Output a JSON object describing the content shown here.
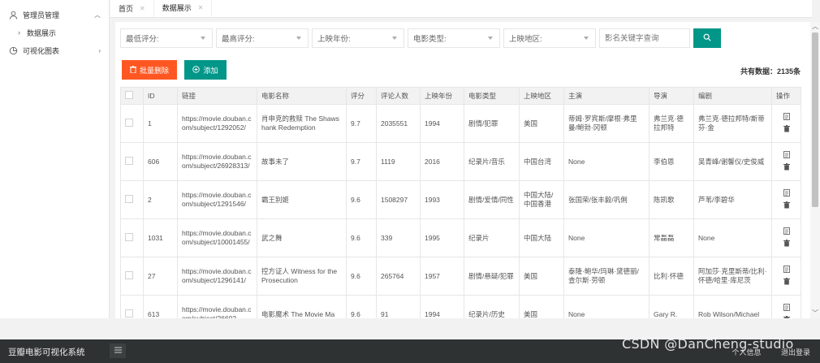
{
  "sidebar": {
    "items": [
      {
        "label": "管理员管理",
        "icon": "user-icon"
      },
      {
        "label": "数据展示"
      },
      {
        "label": "可视化图表",
        "icon": "chart-icon"
      }
    ]
  },
  "tabs": [
    {
      "label": "首页"
    },
    {
      "label": "数据展示"
    }
  ],
  "filters": {
    "min_rating": "最低评分:",
    "max_rating": "最高评分:",
    "year": "上映年份:",
    "type": "电影类型:",
    "region": "上映地区:",
    "search_placeholder": "影名关键字查询"
  },
  "toolbar": {
    "delete_label": "批量删除",
    "add_label": "添加",
    "total_text": "共有数据：2135条"
  },
  "table": {
    "headers": [
      "ID",
      "链接",
      "电影名称",
      "评分",
      "评论人数",
      "上映年份",
      "电影类型",
      "上映地区",
      "主演",
      "导演",
      "编剧",
      "操作"
    ],
    "rows": [
      {
        "id": "1",
        "link": "https://movie.douban.com/subject/1292052/",
        "name": "肖申克的救赎 The Shawshank Redemption",
        "rating": "9.7",
        "reviews": "2035551",
        "year": "1994",
        "type": "剧情/犯罪",
        "region": "美国",
        "actors": "蒂姆·罗宾斯/摩根·弗里曼/鲍勃·冈顿",
        "director": "弗兰克·德拉邦特",
        "writer": "弗兰克·德拉邦特/斯蒂芬·金"
      },
      {
        "id": "606",
        "link": "https://movie.douban.com/subject/26928313/",
        "name": "故事未了",
        "rating": "9.7",
        "reviews": "1119",
        "year": "2016",
        "type": "纪录片/音乐",
        "region": "中国台湾",
        "actors": "None",
        "director": "李伯恩",
        "writer": "吴青峰/谢馨仪/史俊威"
      },
      {
        "id": "2",
        "link": "https://movie.douban.com/subject/1291546/",
        "name": "霸王别姬",
        "rating": "9.6",
        "reviews": "1508297",
        "year": "1993",
        "type": "剧情/爱情/同性",
        "region": "中国大陆/中国香港",
        "actors": "张国荣/张丰毅/巩俐",
        "director": "陈凯歌",
        "writer": "芦苇/李碧华"
      },
      {
        "id": "1031",
        "link": "https://movie.douban.com/subject/10001455/",
        "name": "武之舞",
        "rating": "9.6",
        "reviews": "339",
        "year": "1995",
        "type": "纪录片",
        "region": "中国大陆",
        "actors": "None",
        "director": "常磊磊",
        "writer": "None"
      },
      {
        "id": "27",
        "link": "https://movie.douban.com/subject/1296141/",
        "name": "控方证人 Witness for the Prosecution",
        "rating": "9.6",
        "reviews": "265764",
        "year": "1957",
        "type": "剧情/悬疑/犯罪",
        "region": "美国",
        "actors": "泰隆·鲍华/玛琳·黛德丽/查尔斯·劳顿",
        "director": "比利·怀德",
        "writer": "阿加莎·克里斯蒂/比利·怀德/哈里·库尼茨"
      },
      {
        "id": "613",
        "link": "https://movie.douban.com/subject/26602",
        "name": "电影魔术 The Movie Ma",
        "rating": "9.6",
        "reviews": "91",
        "year": "1994",
        "type": "纪录片/历史",
        "region": "美国",
        "actors": "None",
        "director": "Gary R.",
        "writer": "Rob Wilson/Michael"
      }
    ]
  },
  "footer": {
    "brand": "豆瓣电影可视化系统",
    "link1": "个人信息",
    "link2": "退出登录"
  },
  "watermark": "CSDN @DanCheng-studio",
  "colors": {
    "primary": "#009688",
    "danger": "#ff5722",
    "footer": "#2f3233"
  }
}
